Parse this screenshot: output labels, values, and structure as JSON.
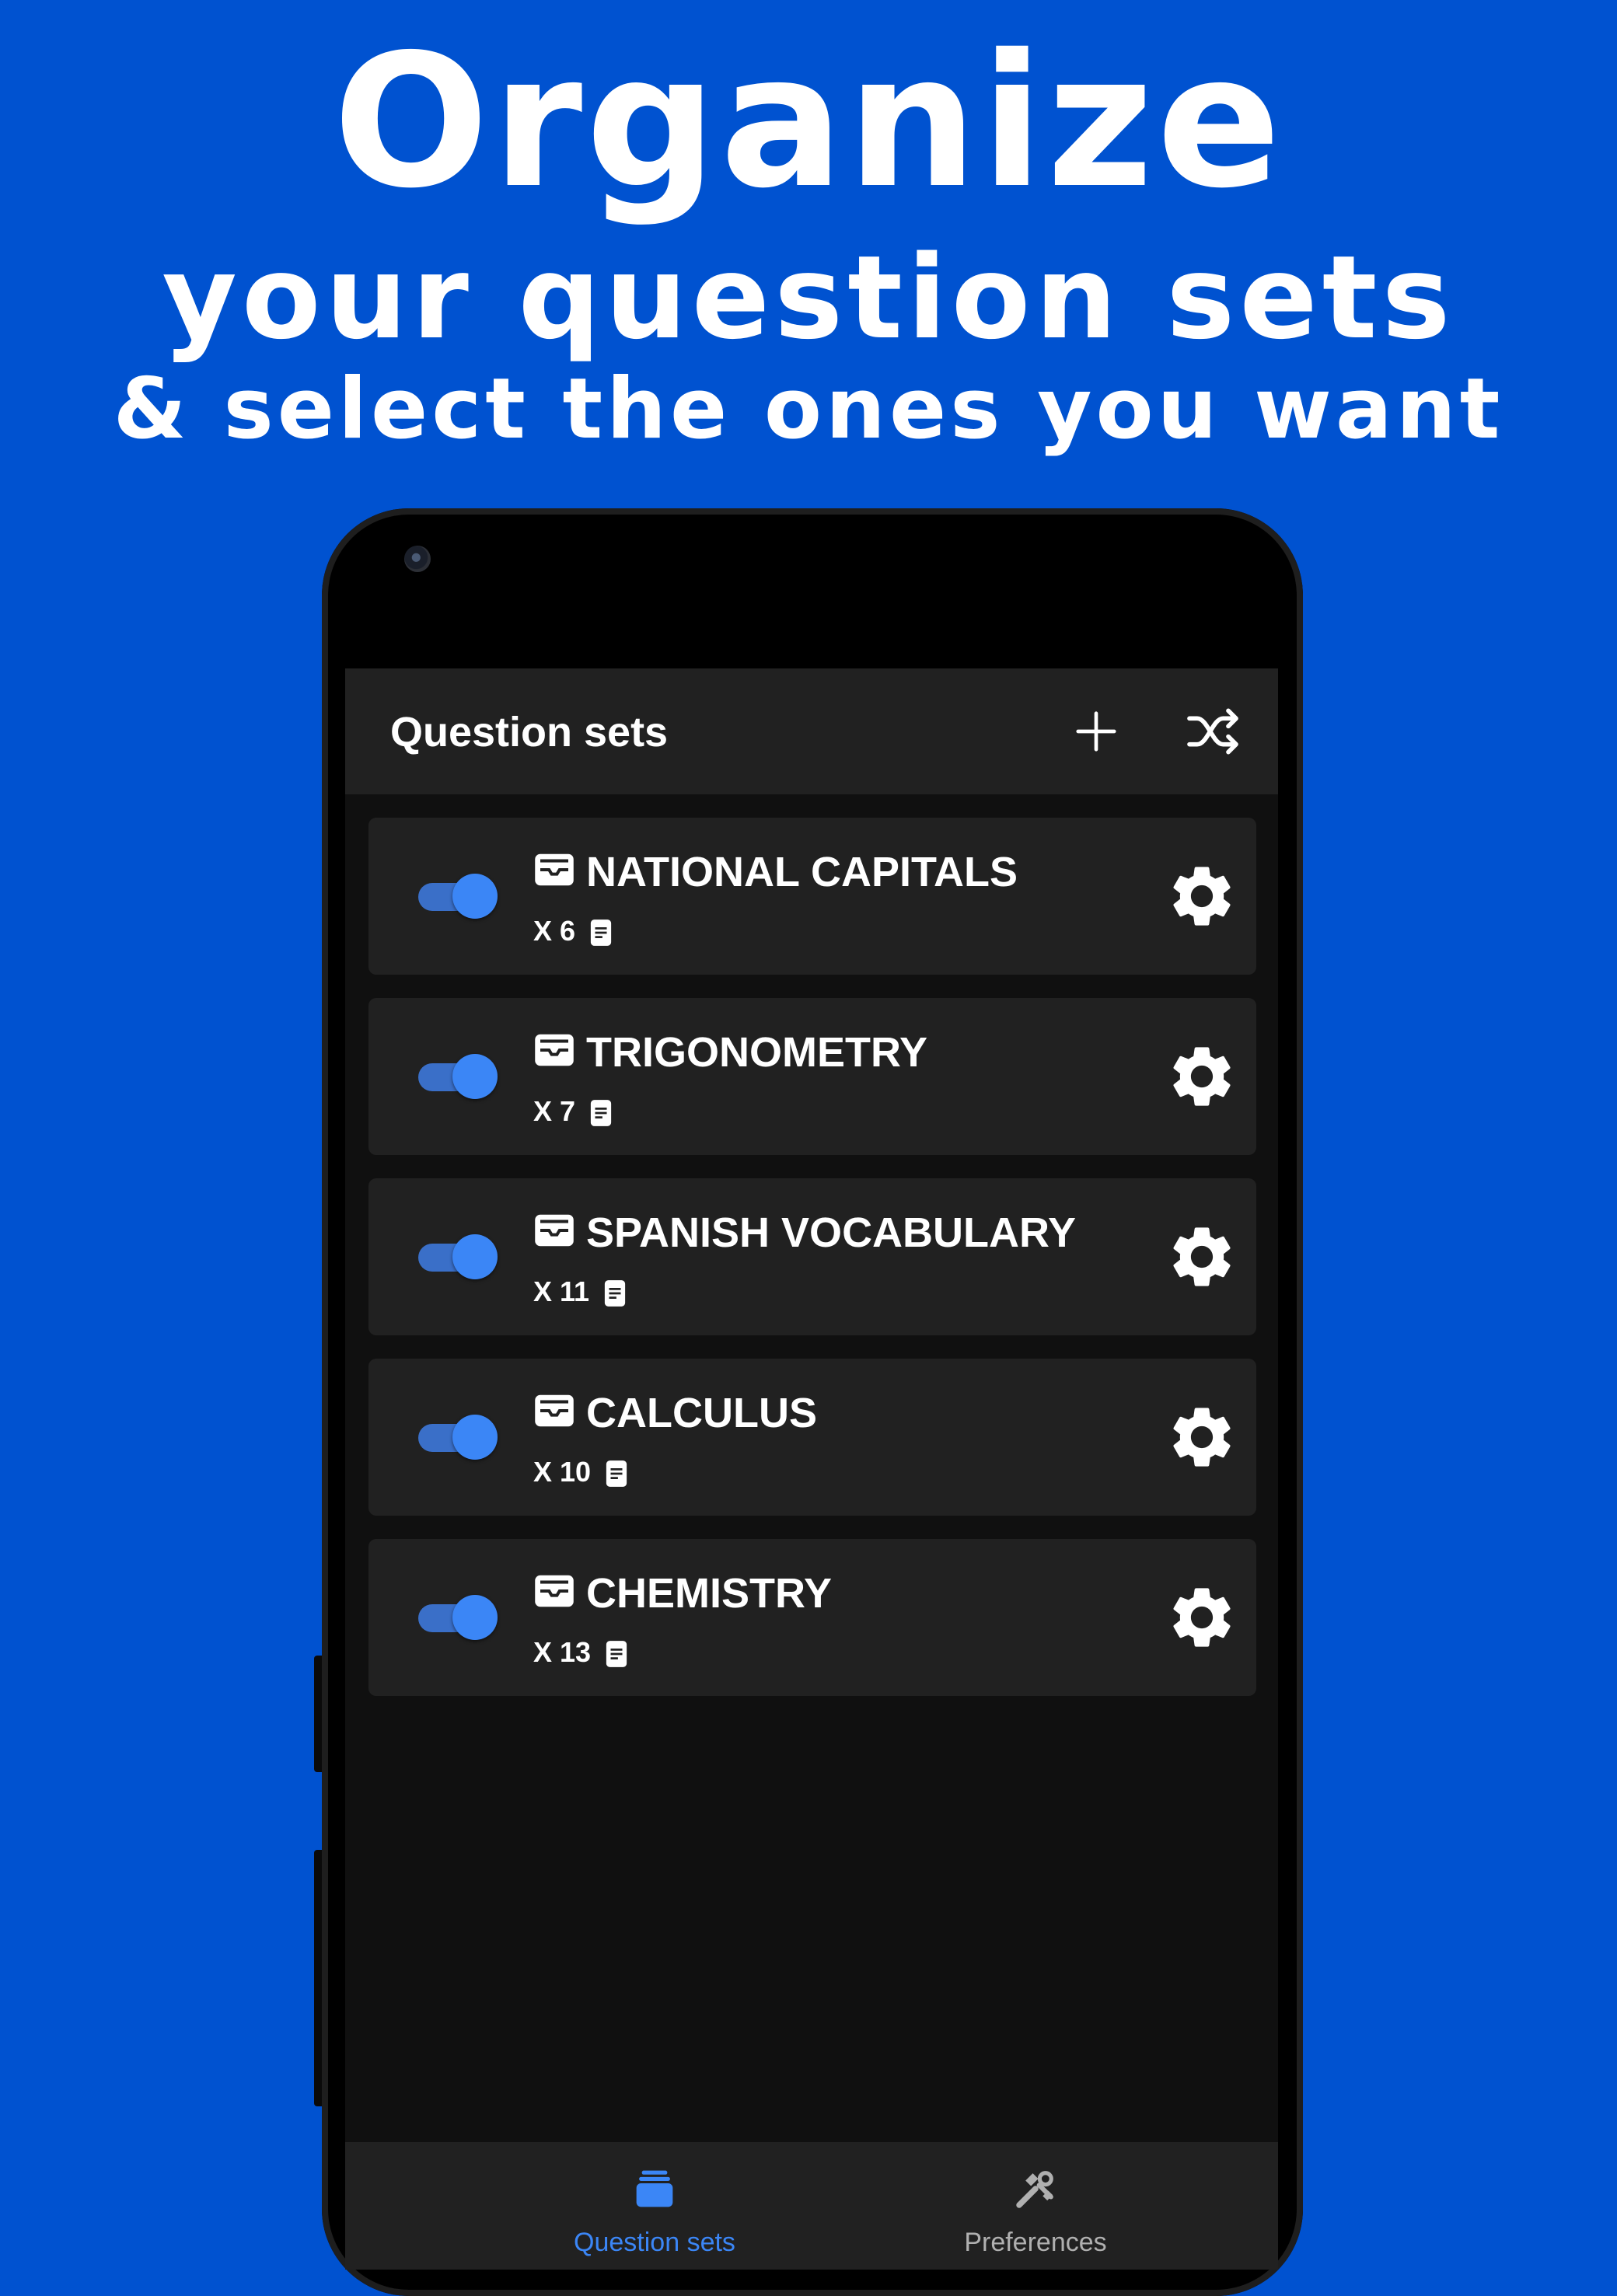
{
  "promo": {
    "headline": "Organize",
    "subheadline": "your question sets",
    "tagline": "& select the ones you want"
  },
  "app": {
    "title": "Question sets",
    "actions": {
      "add_icon": "plus-icon",
      "shuffle_icon": "shuffle-icon"
    },
    "question_sets": [
      {
        "name": "NATIONAL CAPITALS",
        "count": "X 6",
        "enabled": true
      },
      {
        "name": "TRIGONOMETRY",
        "count": "X 7",
        "enabled": true
      },
      {
        "name": "SPANISH VOCABULARY",
        "count": "X 11",
        "enabled": true
      },
      {
        "name": "CALCULUS",
        "count": "X 10",
        "enabled": true
      },
      {
        "name": "CHEMISTRY",
        "count": "X 13",
        "enabled": true
      }
    ],
    "bottom_nav": [
      {
        "label": "Question sets",
        "icon": "stacked-cards-icon",
        "active": true
      },
      {
        "label": "Preferences",
        "icon": "tools-icon",
        "active": false
      }
    ]
  },
  "colors": {
    "background": "#0052d0",
    "accent": "#3b86f6",
    "surface": "#212121",
    "screen": "#101010",
    "inactive": "#b0b0b0"
  }
}
